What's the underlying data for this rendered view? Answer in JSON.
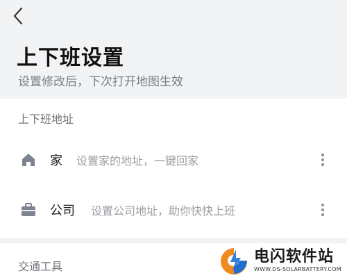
{
  "header": {
    "title": "上下班设置",
    "subtitle": "设置修改后，下次打开地图生效"
  },
  "address_section": {
    "label": "上下班地址",
    "items": [
      {
        "name": "家",
        "hint": "设置家的地址，一键回家",
        "icon": "home-icon"
      },
      {
        "name": "公司",
        "hint": "设置公司地址，助你快快上班",
        "icon": "briefcase-icon"
      }
    ]
  },
  "traffic_section": {
    "label": "交通工具"
  },
  "watermark": {
    "title": "电闪软件站",
    "url": "WWW.DS-SOLARBATTERY.COM"
  },
  "colors": {
    "background": "#f2f3f5",
    "card": "#ffffff",
    "icon_gray": "#7d8391",
    "logo_orange": "#f08a1c",
    "logo_blue": "#1f6fd1"
  }
}
